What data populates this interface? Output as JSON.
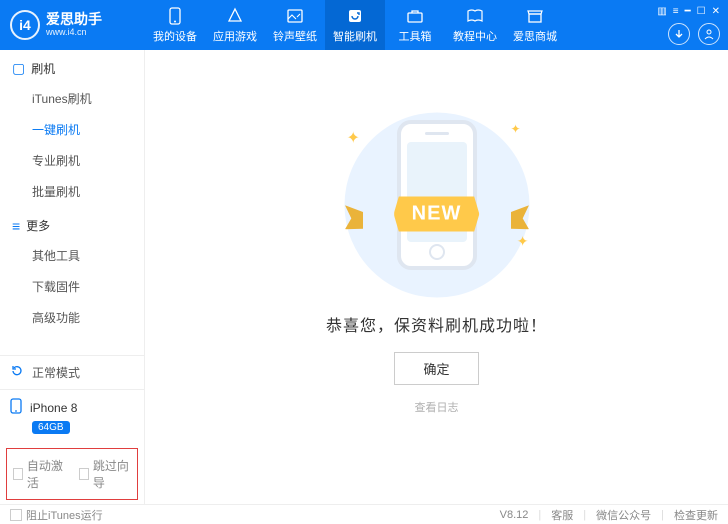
{
  "logo": {
    "badge": "i4",
    "title": "爱思助手",
    "url": "www.i4.cn"
  },
  "nav": [
    {
      "label": "我的设备"
    },
    {
      "label": "应用游戏"
    },
    {
      "label": "铃声壁纸"
    },
    {
      "label": "智能刷机"
    },
    {
      "label": "工具箱"
    },
    {
      "label": "教程中心"
    },
    {
      "label": "爱思商城"
    }
  ],
  "sidebar": {
    "group1": {
      "title": "刷机",
      "items": [
        {
          "label": "iTunes刷机"
        },
        {
          "label": "一键刷机"
        },
        {
          "label": "专业刷机"
        },
        {
          "label": "批量刷机"
        }
      ]
    },
    "group2": {
      "title": "更多",
      "items": [
        {
          "label": "其他工具"
        },
        {
          "label": "下载固件"
        },
        {
          "label": "高级功能"
        }
      ]
    },
    "mode": "正常模式",
    "device": {
      "name": "iPhone 8",
      "storage": "64GB"
    },
    "checks": {
      "auto_activate": "自动激活",
      "skip_wizard": "跳过向导"
    }
  },
  "main": {
    "ribbon": "NEW",
    "success_text": "恭喜您，保资料刷机成功啦！",
    "ok_button": "确定",
    "log_link": "查看日志"
  },
  "statusbar": {
    "block_itunes": "阻止iTunes运行",
    "version": "V8.12",
    "support": "客服",
    "wechat": "微信公众号",
    "check_update": "检查更新"
  }
}
